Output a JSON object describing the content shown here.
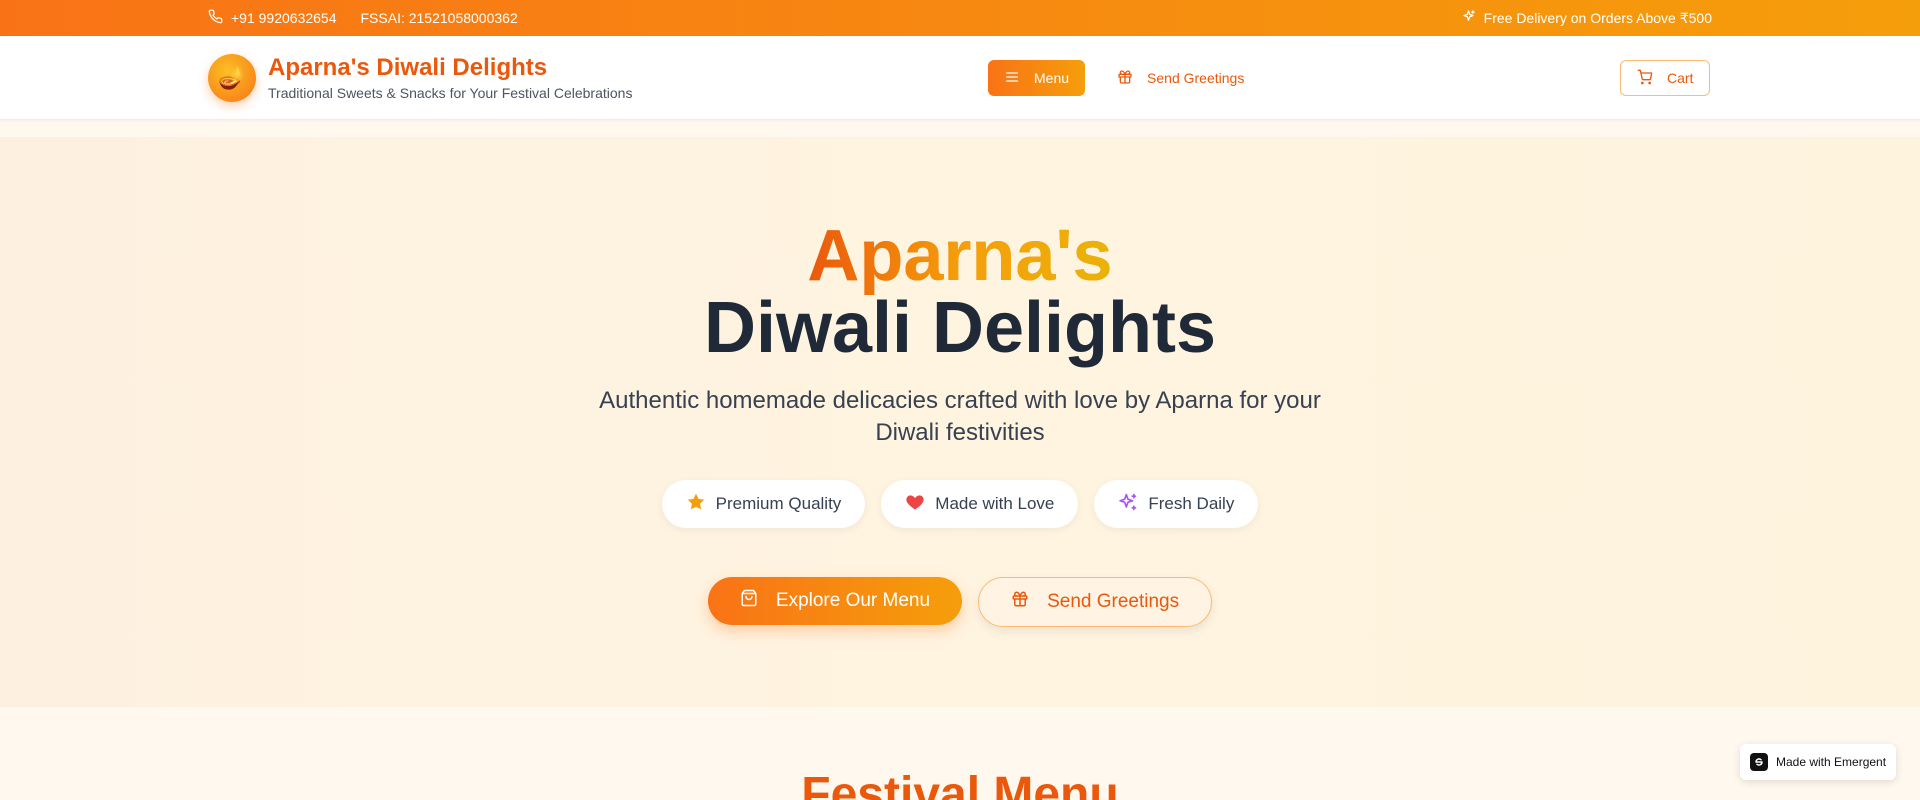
{
  "topbar": {
    "phone": "+91 9920632654",
    "fssai": "FSSAI: 21521058000362",
    "promo": "Free Delivery on Orders Above ₹500"
  },
  "header": {
    "logo_emoji": "🪔",
    "title": "Aparna's Diwali Delights",
    "subtitle": "Traditional Sweets & Snacks for Your Festival Celebrations",
    "menu_label": "Menu",
    "greetings_label": "Send Greetings",
    "cart_label": "Cart"
  },
  "hero": {
    "title_line1": "Aparna's",
    "title_line2": "Diwali Delights",
    "description": "Authentic homemade delicacies crafted with love by Aparna for your Diwali festivities",
    "features": [
      {
        "label": "Premium Quality",
        "icon": "star-icon",
        "color": "#f59e0b"
      },
      {
        "label": "Made with Love",
        "icon": "heart-icon",
        "color": "#ef4444"
      },
      {
        "label": "Fresh Daily",
        "icon": "sparkles-icon",
        "color": "#a855f7"
      }
    ],
    "cta_primary": "Explore Our Menu",
    "cta_secondary": "Send Greetings"
  },
  "section": {
    "title": "Festival Menu"
  },
  "badge": {
    "label": "Made with Emergent"
  },
  "colors": {
    "accent": "#f97316",
    "brand_text": "#ea580c",
    "gold": "#eab308"
  }
}
